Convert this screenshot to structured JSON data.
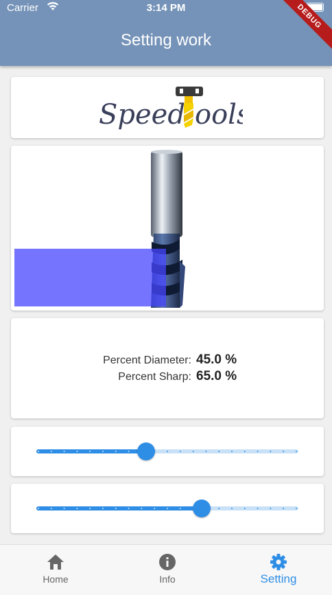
{
  "status_bar": {
    "carrier": "Carrier",
    "time": "3:14 PM"
  },
  "app_bar": {
    "title": "Setting work"
  },
  "debug_banner": "DEBUG",
  "logo": {
    "text_left": "Speed",
    "text_right": "ools"
  },
  "info": {
    "rows": [
      {
        "label": "Percent Diameter:",
        "value": "45.0 %"
      },
      {
        "label": "Percent Sharp:",
        "value": "65.0 %"
      }
    ]
  },
  "sliders": [
    {
      "name": "diameter",
      "value": 0.42
    },
    {
      "name": "sharp",
      "value": 0.63
    }
  ],
  "bottom_nav": {
    "items": [
      {
        "label": "Home",
        "icon": "home-icon",
        "active": false
      },
      {
        "label": "Info",
        "icon": "info-icon",
        "active": false
      },
      {
        "label": "Setting",
        "icon": "gear-icon",
        "active": true
      }
    ]
  },
  "colors": {
    "app_bar": "#7593b8",
    "accent": "#2e8ee6",
    "overlay": "#4646ff",
    "debug": "#b71c1c"
  }
}
